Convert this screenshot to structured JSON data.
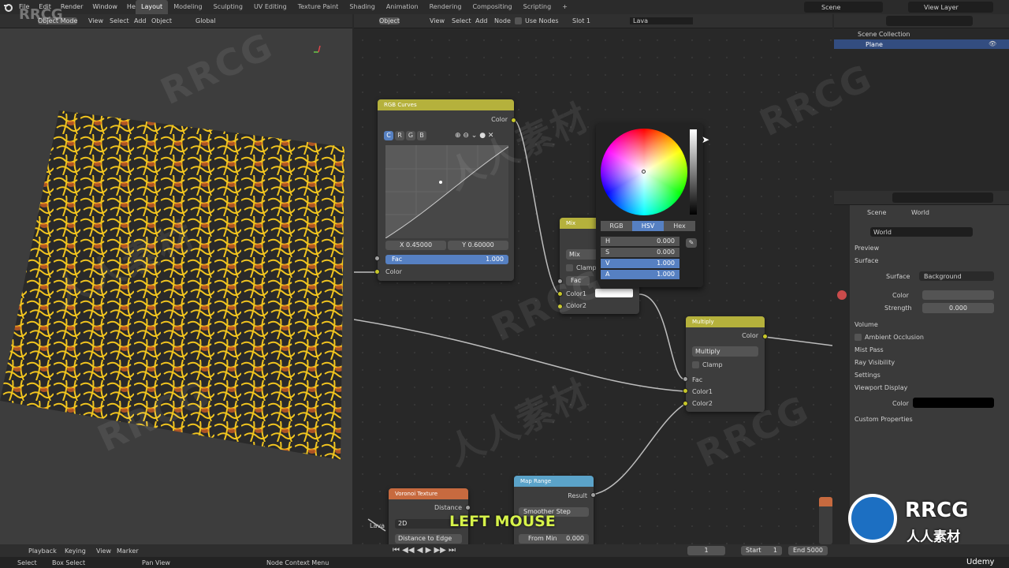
{
  "menu": [
    "File",
    "Edit",
    "Render",
    "Window",
    "Help"
  ],
  "workspaces": [
    "Layout",
    "Modeling",
    "Sculpting",
    "UV Editing",
    "Texture Paint",
    "Shading",
    "Animation",
    "Rendering",
    "Compositing",
    "Scripting",
    "+"
  ],
  "scene": "Scene",
  "view_layer": "View Layer",
  "viewport": {
    "mode": "Object Mode",
    "view": "View",
    "select": "Select",
    "add": "Add",
    "object": "Object",
    "orientation": "Global"
  },
  "node_editor": {
    "type": "Object",
    "view": "View",
    "select": "Select",
    "add": "Add",
    "node": "Node",
    "use_nodes": "Use Nodes",
    "slot": "Slot 1",
    "material": "Lava"
  },
  "outliner": {
    "collection": "Scene Collection",
    "item": "Plane"
  },
  "rgb_curves": {
    "title": "RGB Curves",
    "output": "Color",
    "tabs": [
      "C",
      "R",
      "G",
      "B"
    ],
    "x": "X 0.45000",
    "y": "Y 0.60000",
    "fac_label": "Fac",
    "fac_value": "1.000",
    "input": "Color"
  },
  "mix": {
    "title": "Mix",
    "mode": "Mix",
    "clamp": "Clamp",
    "fac": "Fac",
    "color1": "Color1",
    "color2": "Color2"
  },
  "color_picker": {
    "tabs": [
      "RGB",
      "HSV",
      "Hex"
    ],
    "rows": [
      {
        "k": "H",
        "v": "0.000"
      },
      {
        "k": "S",
        "v": "0.000"
      },
      {
        "k": "V",
        "v": "1.000"
      },
      {
        "k": "A",
        "v": "1.000"
      }
    ]
  },
  "multiply": {
    "title": "Multiply",
    "output": "Color",
    "mode": "Multiply",
    "clamp": "Clamp",
    "fac": "Fac",
    "color1": "Color1",
    "color2": "Color2"
  },
  "voronoi": {
    "title": "Voronoi Texture",
    "output": "Distance",
    "dim": "2D",
    "feature": "Distance to Edge"
  },
  "map_range": {
    "title": "Map Range",
    "output": "Result",
    "interp": "Smoother Step",
    "from_min_label": "From Min",
    "from_min_value": "0.000"
  },
  "lava_label": "Lava",
  "overlay_text": "LEFT MOUSE",
  "properties": {
    "breadcrumb_scene": "Scene",
    "breadcrumb_world": "World",
    "world": "World",
    "preview": "Preview",
    "surface": "Surface",
    "surface_label": "Surface",
    "surface_value": "Background",
    "color_label": "Color",
    "strength_label": "Strength",
    "strength_value": "0.000",
    "volume": "Volume",
    "ao": "Ambient Occlusion",
    "mist": "Mist Pass",
    "ray": "Ray Visibility",
    "settings": "Settings",
    "viewport_display": "Viewport Display",
    "vd_color": "Color",
    "custom": "Custom Properties"
  },
  "timeline": {
    "playback": "Playback",
    "keying": "Keying",
    "view": "View",
    "marker": "Marker",
    "frame": "1",
    "start_label": "Start",
    "start": "1",
    "end_label": "End",
    "end": "5000"
  },
  "status": {
    "select": "Select",
    "box_select": "Box Select",
    "pan_view": "Pan View",
    "context_menu": "Node Context Menu"
  },
  "watermarks": [
    "RRCG",
    "人人素材"
  ],
  "brand": {
    "logo": "RRCG",
    "sub": "人人素材",
    "udemy": "Udemy"
  }
}
